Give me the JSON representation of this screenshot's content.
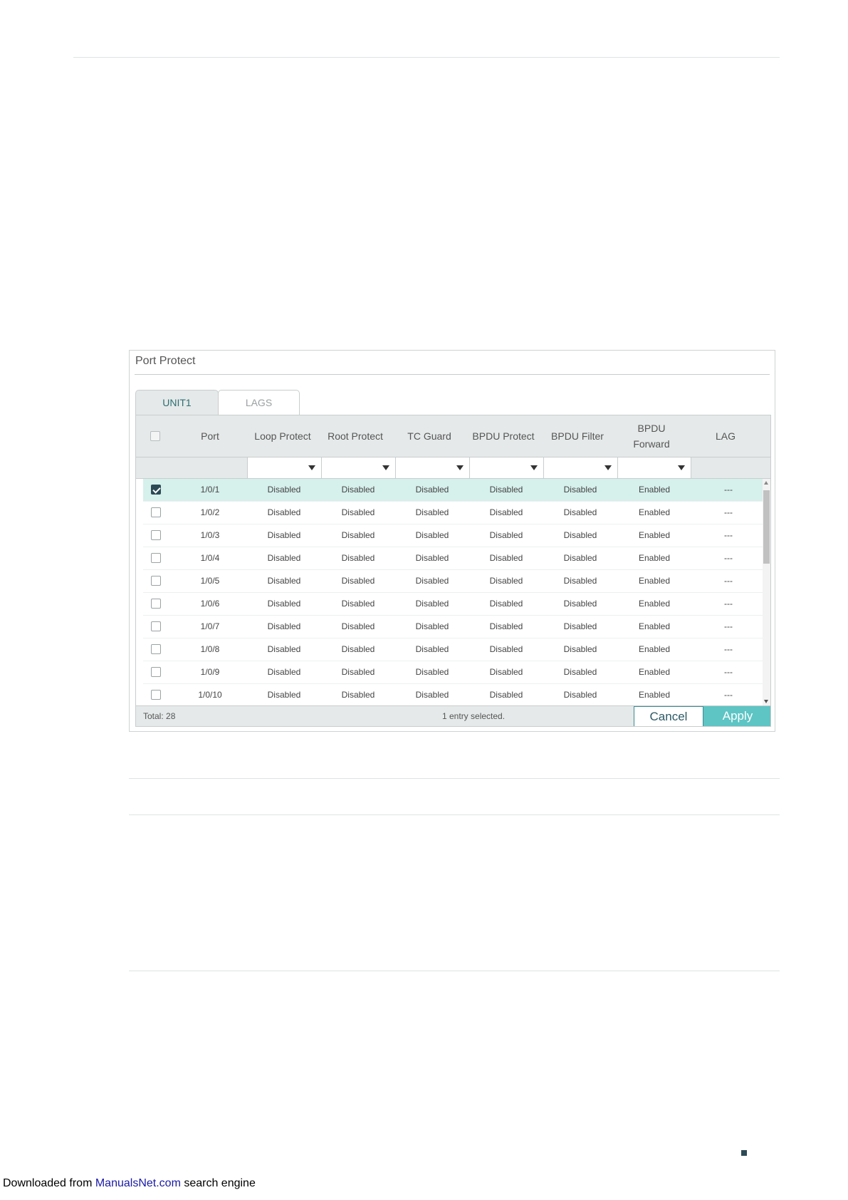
{
  "panel": {
    "title": "Port Protect",
    "tabs": [
      {
        "label": "UNIT1"
      },
      {
        "label": "LAGS"
      }
    ]
  },
  "table": {
    "columns": [
      "Port",
      "Loop Protect",
      "Root Protect",
      "TC Guard",
      "BPDU Protect",
      "BPDU Filter",
      "BPDU\nForward",
      "LAG"
    ],
    "rows": [
      {
        "port": "1/0/1",
        "loop": "Disabled",
        "root": "Disabled",
        "tc": "Disabled",
        "bpdu_protect": "Disabled",
        "bpdu_filter": "Disabled",
        "bpdu_forward": "Enabled",
        "lag": "---",
        "checked": true
      },
      {
        "port": "1/0/2",
        "loop": "Disabled",
        "root": "Disabled",
        "tc": "Disabled",
        "bpdu_protect": "Disabled",
        "bpdu_filter": "Disabled",
        "bpdu_forward": "Enabled",
        "lag": "---",
        "checked": false
      },
      {
        "port": "1/0/3",
        "loop": "Disabled",
        "root": "Disabled",
        "tc": "Disabled",
        "bpdu_protect": "Disabled",
        "bpdu_filter": "Disabled",
        "bpdu_forward": "Enabled",
        "lag": "---",
        "checked": false
      },
      {
        "port": "1/0/4",
        "loop": "Disabled",
        "root": "Disabled",
        "tc": "Disabled",
        "bpdu_protect": "Disabled",
        "bpdu_filter": "Disabled",
        "bpdu_forward": "Enabled",
        "lag": "---",
        "checked": false
      },
      {
        "port": "1/0/5",
        "loop": "Disabled",
        "root": "Disabled",
        "tc": "Disabled",
        "bpdu_protect": "Disabled",
        "bpdu_filter": "Disabled",
        "bpdu_forward": "Enabled",
        "lag": "---",
        "checked": false
      },
      {
        "port": "1/0/6",
        "loop": "Disabled",
        "root": "Disabled",
        "tc": "Disabled",
        "bpdu_protect": "Disabled",
        "bpdu_filter": "Disabled",
        "bpdu_forward": "Enabled",
        "lag": "---",
        "checked": false
      },
      {
        "port": "1/0/7",
        "loop": "Disabled",
        "root": "Disabled",
        "tc": "Disabled",
        "bpdu_protect": "Disabled",
        "bpdu_filter": "Disabled",
        "bpdu_forward": "Enabled",
        "lag": "---",
        "checked": false
      },
      {
        "port": "1/0/8",
        "loop": "Disabled",
        "root": "Disabled",
        "tc": "Disabled",
        "bpdu_protect": "Disabled",
        "bpdu_filter": "Disabled",
        "bpdu_forward": "Enabled",
        "lag": "---",
        "checked": false
      },
      {
        "port": "1/0/9",
        "loop": "Disabled",
        "root": "Disabled",
        "tc": "Disabled",
        "bpdu_protect": "Disabled",
        "bpdu_filter": "Disabled",
        "bpdu_forward": "Enabled",
        "lag": "---",
        "checked": false
      },
      {
        "port": "1/0/10",
        "loop": "Disabled",
        "root": "Disabled",
        "tc": "Disabled",
        "bpdu_protect": "Disabled",
        "bpdu_filter": "Disabled",
        "bpdu_forward": "Enabled",
        "lag": "---",
        "checked": false
      }
    ],
    "footer": {
      "total": "Total: 28",
      "selection": "1 entry selected.",
      "cancel_label": "Cancel",
      "apply_label": "Apply"
    }
  },
  "download_note": {
    "prefix": "Downloaded from ",
    "link": "ManualsNet.com",
    "suffix": " search engine"
  },
  "colors": {
    "accent": "#5ec4c4",
    "selected_row": "#d6f0ec",
    "header_bg": "#e5e9e9",
    "checkbox_on": "#2c4a55"
  }
}
